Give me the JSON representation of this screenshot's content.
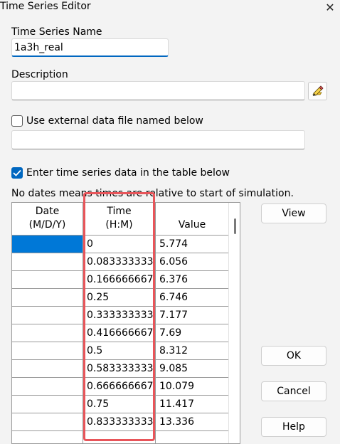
{
  "window": {
    "title": "Time Series Editor",
    "close_icon": "close-icon"
  },
  "name_label": "Time Series Name",
  "name_value": "1a3h_real",
  "description_label": "Description",
  "description_value": "",
  "external_file": {
    "label": "Use external data file named below",
    "checked": false,
    "path": ""
  },
  "table_option": {
    "label": "Enter time series data in the table below",
    "checked": true
  },
  "note": "No dates means times are relative to start of simulation.",
  "table": {
    "headers": {
      "date_line1": "Date",
      "date_line2": "(M/D/Y)",
      "time_line1": "Time",
      "time_line2": "(H:M)",
      "value": "Value"
    },
    "rows": [
      {
        "date": "",
        "time": "0",
        "value": "5.774"
      },
      {
        "date": "",
        "time": "0.083333333",
        "value": "6.056"
      },
      {
        "date": "",
        "time": "0.166666667",
        "value": "6.376"
      },
      {
        "date": "",
        "time": "0.25",
        "value": "6.746"
      },
      {
        "date": "",
        "time": "0.333333333",
        "value": "7.177"
      },
      {
        "date": "",
        "time": "0.416666667",
        "value": "7.69"
      },
      {
        "date": "",
        "time": "0.5",
        "value": "8.312"
      },
      {
        "date": "",
        "time": "0.583333333",
        "value": "9.085"
      },
      {
        "date": "",
        "time": "0.666666667",
        "value": "10.079"
      },
      {
        "date": "",
        "time": "0.75",
        "value": "11.417"
      },
      {
        "date": "",
        "time": "0.833333333",
        "value": "13.336"
      }
    ]
  },
  "buttons": {
    "view": "View",
    "ok": "OK",
    "cancel": "Cancel",
    "help": "Help"
  },
  "colors": {
    "accent": "#0067c0",
    "selection": "#0078d7",
    "highlight_box": "#e8555a"
  }
}
